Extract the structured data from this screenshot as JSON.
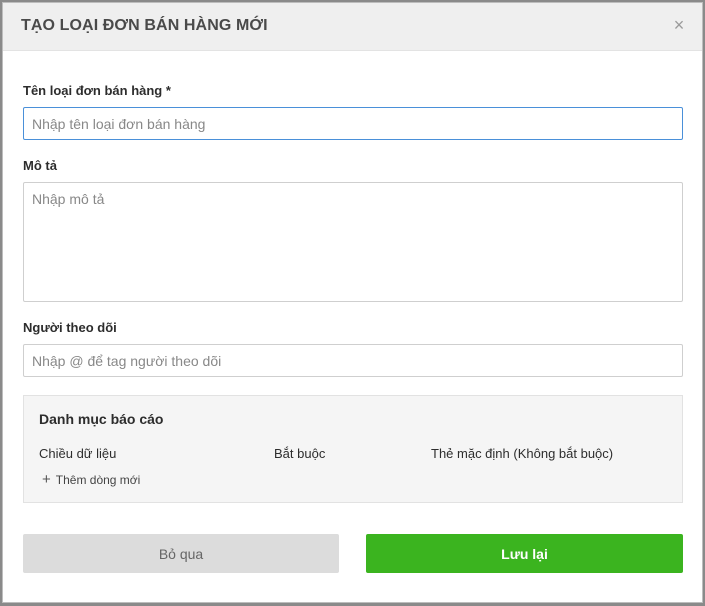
{
  "dialog": {
    "title": "TẠO LOẠI ĐƠN BÁN HÀNG MỚI",
    "close_icon": "×"
  },
  "form": {
    "name": {
      "label": "Tên loại đơn bán hàng *",
      "placeholder": "Nhập tên loại đơn bán hàng",
      "value": ""
    },
    "description": {
      "label": "Mô tả",
      "placeholder": "Nhập mô tả",
      "value": ""
    },
    "followers": {
      "label": "Người theo dõi",
      "placeholder": "Nhập @ để tag người theo dõi",
      "value": ""
    }
  },
  "report": {
    "title": "Danh mục báo cáo",
    "columns": [
      "Chiều dữ liệu",
      "Bắt buộc",
      "Thẻ mặc định (Không bắt buộc)"
    ],
    "add_row_label": "Thêm dòng mới",
    "add_row_icon": "+"
  },
  "actions": {
    "cancel_label": "Bỏ qua",
    "save_label": "Lưu lại"
  },
  "colors": {
    "save": "#3bb41f",
    "cancel": "#dcdcdc",
    "focus_border": "#4a90d9"
  }
}
